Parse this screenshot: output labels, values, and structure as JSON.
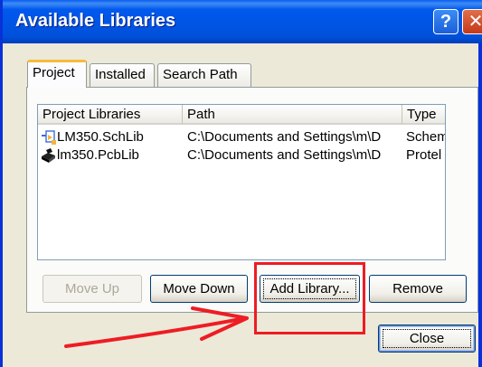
{
  "window": {
    "title": "Available Libraries",
    "help_label": "?",
    "close_label": "✕"
  },
  "tabs": [
    {
      "label": "Project"
    },
    {
      "label": "Installed"
    },
    {
      "label": "Search Path"
    }
  ],
  "list": {
    "columns": [
      "Project Libraries",
      "Path",
      "Type"
    ],
    "rows": [
      {
        "name": "LM350.SchLib",
        "path": "C:\\Documents and Settings\\m\\D",
        "type": "Schemati",
        "icon": "schlib-icon"
      },
      {
        "name": "lm350.PcbLib",
        "path": "C:\\Documents and Settings\\m\\D",
        "type": "Protel Fo",
        "icon": "pcblib-icon"
      }
    ]
  },
  "buttons": {
    "move_up": "Move Up",
    "move_down": "Move Down",
    "add_library": "Add Library...",
    "remove": "Remove",
    "close": "Close"
  },
  "colors": {
    "titlebar": "#0054e3",
    "annotation": "#ee1c24"
  }
}
